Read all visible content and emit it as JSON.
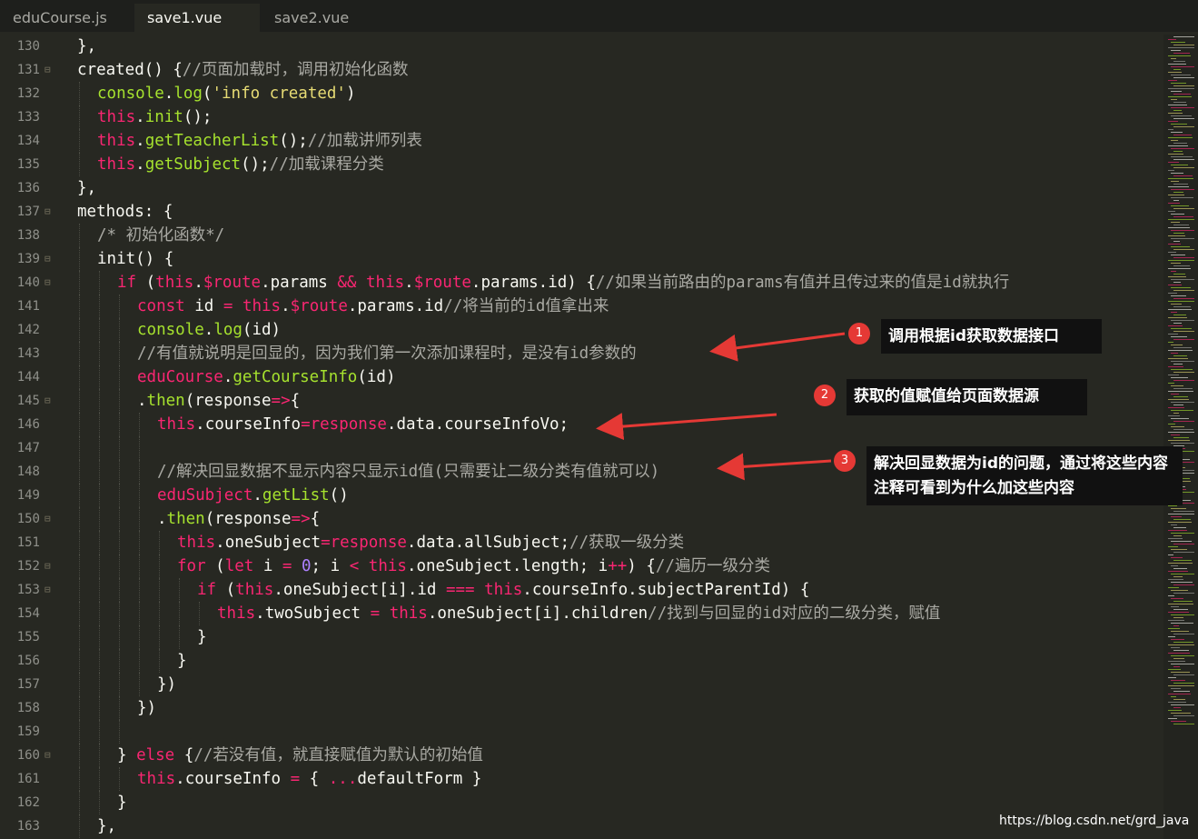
{
  "tabs": [
    {
      "label": "eduCourse.js",
      "active": false
    },
    {
      "label": "save1.vue",
      "active": true
    },
    {
      "label": "save2.vue",
      "active": false
    }
  ],
  "lines": [
    {
      "num": "130",
      "fold": false,
      "indent": 1,
      "tokens": [
        {
          "t": "plain",
          "v": "},"
        }
      ]
    },
    {
      "num": "131",
      "fold": true,
      "indent": 1,
      "tokens": [
        {
          "t": "plain",
          "v": "created() {"
        },
        {
          "t": "cm",
          "v": "//页面加载时，调用初始化函数"
        }
      ]
    },
    {
      "num": "132",
      "fold": false,
      "indent": 2,
      "tokens": [
        {
          "t": "fn",
          "v": "console"
        },
        {
          "t": "plain",
          "v": "."
        },
        {
          "t": "fn",
          "v": "log"
        },
        {
          "t": "plain",
          "v": "("
        },
        {
          "t": "str",
          "v": "'info created'"
        },
        {
          "t": "plain",
          "v": ")"
        }
      ]
    },
    {
      "num": "133",
      "fold": false,
      "indent": 2,
      "tokens": [
        {
          "t": "this",
          "v": "this"
        },
        {
          "t": "plain",
          "v": "."
        },
        {
          "t": "fn",
          "v": "init"
        },
        {
          "t": "plain",
          "v": "();"
        }
      ]
    },
    {
      "num": "134",
      "fold": false,
      "indent": 2,
      "tokens": [
        {
          "t": "this",
          "v": "this"
        },
        {
          "t": "plain",
          "v": "."
        },
        {
          "t": "fn",
          "v": "getTeacherList"
        },
        {
          "t": "plain",
          "v": "();"
        },
        {
          "t": "cm",
          "v": "//加载讲师列表"
        }
      ]
    },
    {
      "num": "135",
      "fold": false,
      "indent": 2,
      "tokens": [
        {
          "t": "this",
          "v": "this"
        },
        {
          "t": "plain",
          "v": "."
        },
        {
          "t": "fn",
          "v": "getSubject"
        },
        {
          "t": "plain",
          "v": "();"
        },
        {
          "t": "cm",
          "v": "//加载课程分类"
        }
      ]
    },
    {
      "num": "136",
      "fold": false,
      "indent": 1,
      "tokens": [
        {
          "t": "plain",
          "v": "},"
        }
      ]
    },
    {
      "num": "137",
      "fold": true,
      "indent": 1,
      "tokens": [
        {
          "t": "plain",
          "v": "methods: {"
        }
      ]
    },
    {
      "num": "138",
      "fold": false,
      "indent": 2,
      "tokens": [
        {
          "t": "cm",
          "v": "/* 初始化函数*/"
        }
      ]
    },
    {
      "num": "139",
      "fold": true,
      "indent": 2,
      "tokens": [
        {
          "t": "plain",
          "v": "init() {"
        }
      ]
    },
    {
      "num": "140",
      "fold": true,
      "indent": 3,
      "tokens": [
        {
          "t": "kw",
          "v": "if"
        },
        {
          "t": "plain",
          "v": " ("
        },
        {
          "t": "this",
          "v": "this"
        },
        {
          "t": "plain",
          "v": "."
        },
        {
          "t": "kw",
          "v": "$route"
        },
        {
          "t": "plain",
          "v": ".params "
        },
        {
          "t": "kw",
          "v": "&&"
        },
        {
          "t": "plain",
          "v": " "
        },
        {
          "t": "this",
          "v": "this"
        },
        {
          "t": "plain",
          "v": "."
        },
        {
          "t": "kw",
          "v": "$route"
        },
        {
          "t": "plain",
          "v": ".params.id) {"
        },
        {
          "t": "cm",
          "v": "//如果当前路由的params有值并且传过来的值是id就执行"
        }
      ]
    },
    {
      "num": "141",
      "fold": false,
      "indent": 4,
      "tokens": [
        {
          "t": "kw",
          "v": "const"
        },
        {
          "t": "plain",
          "v": " id "
        },
        {
          "t": "kw",
          "v": "="
        },
        {
          "t": "plain",
          "v": " "
        },
        {
          "t": "this",
          "v": "this"
        },
        {
          "t": "plain",
          "v": "."
        },
        {
          "t": "kw",
          "v": "$route"
        },
        {
          "t": "plain",
          "v": ".params.id"
        },
        {
          "t": "cm",
          "v": "//将当前的id值拿出来"
        }
      ]
    },
    {
      "num": "142",
      "fold": false,
      "indent": 4,
      "tokens": [
        {
          "t": "fn",
          "v": "console"
        },
        {
          "t": "plain",
          "v": "."
        },
        {
          "t": "fn",
          "v": "log"
        },
        {
          "t": "plain",
          "v": "(id)"
        }
      ]
    },
    {
      "num": "143",
      "fold": false,
      "indent": 4,
      "tokens": [
        {
          "t": "cm",
          "v": "//有值就说明是回显的，因为我们第一次添加课程时，是没有id参数的"
        }
      ]
    },
    {
      "num": "144",
      "fold": false,
      "indent": 4,
      "tokens": [
        {
          "t": "kw",
          "v": "eduCourse"
        },
        {
          "t": "plain",
          "v": "."
        },
        {
          "t": "fn",
          "v": "getCourseInfo"
        },
        {
          "t": "plain",
          "v": "(id)"
        }
      ]
    },
    {
      "num": "145",
      "fold": true,
      "indent": 4,
      "tokens": [
        {
          "t": "plain",
          "v": "."
        },
        {
          "t": "fn",
          "v": "then"
        },
        {
          "t": "plain",
          "v": "(response"
        },
        {
          "t": "kw",
          "v": "=>"
        },
        {
          "t": "plain",
          "v": "{"
        }
      ]
    },
    {
      "num": "146",
      "fold": false,
      "indent": 5,
      "tokens": [
        {
          "t": "this",
          "v": "this"
        },
        {
          "t": "plain",
          "v": ".courseInfo"
        },
        {
          "t": "kw",
          "v": "="
        },
        {
          "t": "kw",
          "v": "response"
        },
        {
          "t": "plain",
          "v": ".data.courseInfoVo;"
        }
      ]
    },
    {
      "num": "147",
      "fold": false,
      "indent": 5,
      "tokens": []
    },
    {
      "num": "148",
      "fold": false,
      "indent": 5,
      "tokens": [
        {
          "t": "cm",
          "v": "//解决回显数据不显示内容只显示id值(只需要让二级分类有值就可以)"
        }
      ]
    },
    {
      "num": "149",
      "fold": false,
      "indent": 5,
      "tokens": [
        {
          "t": "kw",
          "v": "eduSubject"
        },
        {
          "t": "plain",
          "v": "."
        },
        {
          "t": "fn",
          "v": "getList"
        },
        {
          "t": "plain",
          "v": "()"
        }
      ]
    },
    {
      "num": "150",
      "fold": true,
      "indent": 5,
      "tokens": [
        {
          "t": "plain",
          "v": "."
        },
        {
          "t": "fn",
          "v": "then"
        },
        {
          "t": "plain",
          "v": "(response"
        },
        {
          "t": "kw",
          "v": "=>"
        },
        {
          "t": "plain",
          "v": "{"
        }
      ]
    },
    {
      "num": "151",
      "fold": false,
      "indent": 6,
      "tokens": [
        {
          "t": "this",
          "v": "this"
        },
        {
          "t": "plain",
          "v": ".oneSubject"
        },
        {
          "t": "kw",
          "v": "="
        },
        {
          "t": "kw",
          "v": "response"
        },
        {
          "t": "plain",
          "v": ".data.allSubject;"
        },
        {
          "t": "cm",
          "v": "//获取一级分类"
        }
      ]
    },
    {
      "num": "152",
      "fold": true,
      "indent": 6,
      "tokens": [
        {
          "t": "kw",
          "v": "for"
        },
        {
          "t": "plain",
          "v": " ("
        },
        {
          "t": "kw",
          "v": "let"
        },
        {
          "t": "plain",
          "v": " i "
        },
        {
          "t": "kw",
          "v": "="
        },
        {
          "t": "plain",
          "v": " "
        },
        {
          "t": "num",
          "v": "0"
        },
        {
          "t": "plain",
          "v": "; i "
        },
        {
          "t": "kw",
          "v": "<"
        },
        {
          "t": "plain",
          "v": " "
        },
        {
          "t": "this",
          "v": "this"
        },
        {
          "t": "plain",
          "v": ".oneSubject.length; i"
        },
        {
          "t": "kw",
          "v": "++"
        },
        {
          "t": "plain",
          "v": ") {"
        },
        {
          "t": "cm",
          "v": "//遍历一级分类"
        }
      ]
    },
    {
      "num": "153",
      "fold": true,
      "indent": 7,
      "tokens": [
        {
          "t": "kw",
          "v": "if"
        },
        {
          "t": "plain",
          "v": " ("
        },
        {
          "t": "this",
          "v": "this"
        },
        {
          "t": "plain",
          "v": ".oneSubject[i].id "
        },
        {
          "t": "kw",
          "v": "==="
        },
        {
          "t": "plain",
          "v": " "
        },
        {
          "t": "this",
          "v": "this"
        },
        {
          "t": "plain",
          "v": ".courseInfo.subjectParentId) {"
        }
      ]
    },
    {
      "num": "154",
      "fold": false,
      "indent": 8,
      "tokens": [
        {
          "t": "this",
          "v": "this"
        },
        {
          "t": "plain",
          "v": ".twoSubject "
        },
        {
          "t": "kw",
          "v": "="
        },
        {
          "t": "plain",
          "v": " "
        },
        {
          "t": "this",
          "v": "this"
        },
        {
          "t": "plain",
          "v": ".oneSubject[i].children"
        },
        {
          "t": "cm",
          "v": "//找到与回显的id对应的二级分类，赋值"
        }
      ]
    },
    {
      "num": "155",
      "fold": false,
      "indent": 7,
      "tokens": [
        {
          "t": "plain",
          "v": "}"
        }
      ]
    },
    {
      "num": "156",
      "fold": false,
      "indent": 6,
      "tokens": [
        {
          "t": "plain",
          "v": "}"
        }
      ]
    },
    {
      "num": "157",
      "fold": false,
      "indent": 5,
      "tokens": [
        {
          "t": "plain",
          "v": "})"
        }
      ]
    },
    {
      "num": "158",
      "fold": false,
      "indent": 4,
      "tokens": [
        {
          "t": "plain",
          "v": "})"
        }
      ]
    },
    {
      "num": "159",
      "fold": false,
      "indent": 4,
      "tokens": []
    },
    {
      "num": "160",
      "fold": true,
      "indent": 3,
      "tokens": [
        {
          "t": "plain",
          "v": "} "
        },
        {
          "t": "kw",
          "v": "else"
        },
        {
          "t": "plain",
          "v": " {"
        },
        {
          "t": "cm",
          "v": "//若没有值，就直接赋值为默认的初始值"
        }
      ]
    },
    {
      "num": "161",
      "fold": false,
      "indent": 4,
      "tokens": [
        {
          "t": "this",
          "v": "this"
        },
        {
          "t": "plain",
          "v": ".courseInfo "
        },
        {
          "t": "kw",
          "v": "="
        },
        {
          "t": "plain",
          "v": " { "
        },
        {
          "t": "kw",
          "v": "..."
        },
        {
          "t": "plain",
          "v": "defaultForm }"
        }
      ]
    },
    {
      "num": "162",
      "fold": false,
      "indent": 3,
      "tokens": [
        {
          "t": "plain",
          "v": "}"
        }
      ]
    },
    {
      "num": "163",
      "fold": false,
      "indent": 2,
      "tokens": [
        {
          "t": "plain",
          "v": "},"
        }
      ]
    }
  ],
  "annotations": [
    {
      "badge": "1",
      "text": "调用根据id获取数据接口"
    },
    {
      "badge": "2",
      "text": "获取的值赋值给页面数据源"
    },
    {
      "badge": "3",
      "text": "解决回显数据为id的问题，通过将这些内容注释可看到为什么加这些内容"
    }
  ],
  "watermark": "https://blog.csdn.net/grd_java",
  "colors": {
    "background": "#272822",
    "keyword": "#f92672",
    "function": "#a6e22e",
    "string": "#e6db74",
    "comment": "#a9a9a3",
    "number": "#ae81ff",
    "annotation_bg": "#111111",
    "badge": "#e53935"
  }
}
